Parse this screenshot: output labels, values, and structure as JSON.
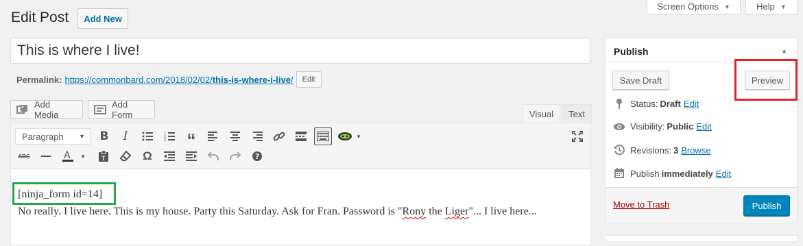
{
  "screen_tabs": {
    "screen_options": "Screen Options",
    "help": "Help"
  },
  "heading": {
    "title": "Edit Post",
    "add_new": "Add New"
  },
  "post": {
    "title_value": "This is where I live!"
  },
  "permalink": {
    "label": "Permalink:",
    "url_base": "https://commonbard.com/2018/02/02/",
    "slug": "this-is-where-i-live",
    "url_end": "/",
    "edit": "Edit"
  },
  "media": {
    "add_media": "Add Media",
    "add_form": "Add Form"
  },
  "editor_tabs": {
    "visual": "Visual",
    "text": "Text"
  },
  "toolbar": {
    "format": "Paragraph"
  },
  "content": {
    "shortcode": "[ninja_form id=14]",
    "para_before": "No really.  I live here.  This is my house.  Party this Saturday.  Ask for Fran.  Password is \"",
    "para_rony": "Rony",
    "para_mid": " the ",
    "para_liger": "Liger",
    "para_after": "\"... I live here..."
  },
  "publish": {
    "title": "Publish",
    "save_draft": "Save Draft",
    "preview": "Preview",
    "status_label": "Status:",
    "status_value": "Draft",
    "visibility_label": "Visibility:",
    "visibility_value": "Public",
    "revisions_label": "Revisions:",
    "revisions_value": "3",
    "browse": "Browse",
    "publish_label": "Publish",
    "publish_value": "immediately",
    "edit": "Edit",
    "trash": "Move to Trash",
    "publish_button": "Publish"
  },
  "colors": {
    "link": "#0073aa",
    "primary": "#0085ba",
    "trash": "#a00",
    "highlight_green": "#2aa54a",
    "highlight_red": "#e0202a"
  },
  "icons": [
    "media-icon",
    "form-icon",
    "bold-icon",
    "italic-icon",
    "bullet-list-icon",
    "numbered-list-icon",
    "blockquote-icon",
    "align-left-icon",
    "align-center-icon",
    "align-right-icon",
    "link-icon",
    "read-more-icon",
    "toolbar-toggle-icon",
    "ninja-forms-icon",
    "fullscreen-icon",
    "strikethrough-icon",
    "horizontal-line-icon",
    "text-color-icon",
    "paste-text-icon",
    "clear-formatting-icon",
    "special-character-icon",
    "outdent-icon",
    "indent-icon",
    "undo-icon",
    "redo-icon",
    "help-icon",
    "pin-icon",
    "eye-icon",
    "history-icon",
    "calendar-icon"
  ]
}
